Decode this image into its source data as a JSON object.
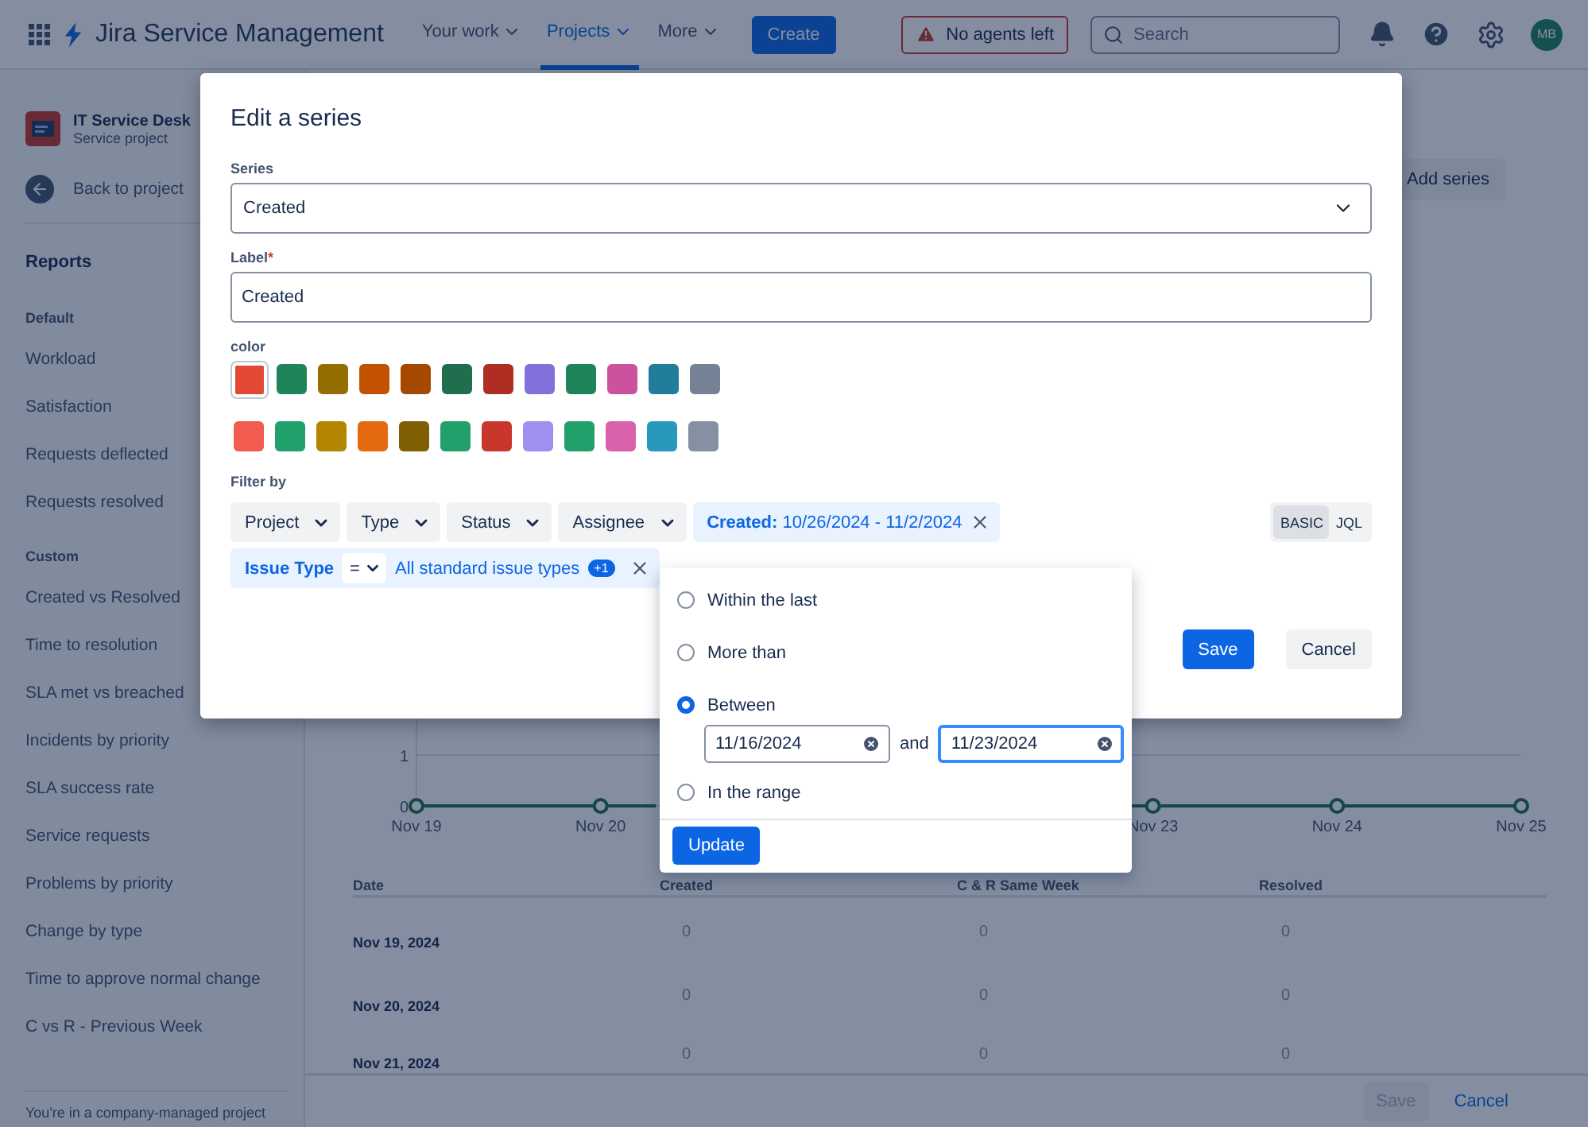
{
  "topbar": {
    "product": "Jira Service Management",
    "nav": [
      {
        "label": "Your work",
        "selected": false
      },
      {
        "label": "Projects",
        "selected": true
      },
      {
        "label": "More",
        "selected": false
      }
    ],
    "create": "Create",
    "alert": "No agents left",
    "search": {
      "placeholder": "Search"
    },
    "avatar": "MB"
  },
  "sidebar": {
    "project": {
      "name": "IT Service Desk",
      "type": "Service project"
    },
    "back": "Back to project",
    "heading": "Reports",
    "groups": [
      {
        "title": "Default",
        "items": [
          "Workload",
          "Satisfaction",
          "Requests deflected",
          "Requests resolved"
        ]
      },
      {
        "title": "Custom",
        "items": [
          "Created vs Resolved",
          "Time to resolution",
          "SLA met vs breached",
          "Incidents by priority",
          "SLA success rate",
          "Service requests",
          "Problems by priority",
          "Change by type",
          "Time to approve normal change",
          "C vs R - Previous Week"
        ]
      }
    ],
    "footer": "You're in a company-managed project"
  },
  "main": {
    "add_series": "Add series",
    "chart": {
      "y_labels": [
        "1",
        "0"
      ],
      "x_labels": [
        "Nov 19",
        "Nov 20",
        "Nov 23",
        "Nov 24",
        "Nov 25"
      ]
    },
    "table": {
      "columns": [
        "Date",
        "Created",
        "C & R Same Week",
        "Resolved"
      ],
      "rows": [
        {
          "date": "Nov 19, 2024",
          "values": [
            "0",
            "0",
            "0"
          ]
        },
        {
          "date": "Nov 20, 2024",
          "values": [
            "0",
            "0",
            "0"
          ]
        },
        {
          "date": "Nov 21, 2024",
          "values": [
            "0",
            "0",
            "0"
          ]
        }
      ]
    },
    "footer": {
      "save": "Save",
      "cancel": "Cancel"
    }
  },
  "dialog": {
    "title": "Edit a series",
    "series": {
      "label": "Series",
      "value": "Created"
    },
    "label_field": {
      "label": "Label",
      "required_mark": "*",
      "value": "Created"
    },
    "color_label": "color",
    "colors": [
      [
        {
          "color": "#e34935",
          "selected": true
        },
        {
          "color": "#1f845a",
          "selected": false
        },
        {
          "color": "#946f00",
          "selected": false
        },
        {
          "color": "#c25100",
          "selected": false
        },
        {
          "color": "#a54800",
          "selected": false
        },
        {
          "color": "#216e4e",
          "selected": false
        },
        {
          "color": "#ae2e24",
          "selected": false
        },
        {
          "color": "#8270db",
          "selected": false
        },
        {
          "color": "#1f845a",
          "selected": false
        },
        {
          "color": "#cd519d",
          "selected": false
        },
        {
          "color": "#227d9b",
          "selected": false
        },
        {
          "color": "#758195",
          "selected": false
        }
      ],
      [
        {
          "color": "#f15b50",
          "selected": false
        },
        {
          "color": "#22a06b",
          "selected": false
        },
        {
          "color": "#b38600",
          "selected": false
        },
        {
          "color": "#e56910",
          "selected": false
        },
        {
          "color": "#7f5f01",
          "selected": false
        },
        {
          "color": "#22a06b",
          "selected": false
        },
        {
          "color": "#c9372c",
          "selected": false
        },
        {
          "color": "#9f8fef",
          "selected": false
        },
        {
          "color": "#22a06b",
          "selected": false
        },
        {
          "color": "#da62ac",
          "selected": false
        },
        {
          "color": "#2898bd",
          "selected": false
        },
        {
          "color": "#8590a2",
          "selected": false
        }
      ]
    ],
    "filter_label": "Filter by",
    "filters": [
      "Project",
      "Type",
      "Status",
      "Assignee"
    ],
    "created_chip": {
      "label": "Created:",
      "value": "10/26/2024 - 11/2/2024"
    },
    "issue_chip": {
      "label": "Issue Type",
      "operator": "=",
      "value": "All standard issue types",
      "badge": "+1"
    },
    "modes": [
      {
        "label": "BASIC",
        "selected": true
      },
      {
        "label": "JQL",
        "selected": false
      }
    ],
    "save": "Save",
    "cancel": "Cancel"
  },
  "popup": {
    "options": [
      {
        "label": "Within the last",
        "selected": false
      },
      {
        "label": "More than",
        "selected": false
      },
      {
        "label": "Between",
        "selected": true
      },
      {
        "label": "In the range",
        "selected": false
      }
    ],
    "from": "11/16/2024",
    "joiner": "and",
    "to": "11/23/2024",
    "update": "Update"
  }
}
